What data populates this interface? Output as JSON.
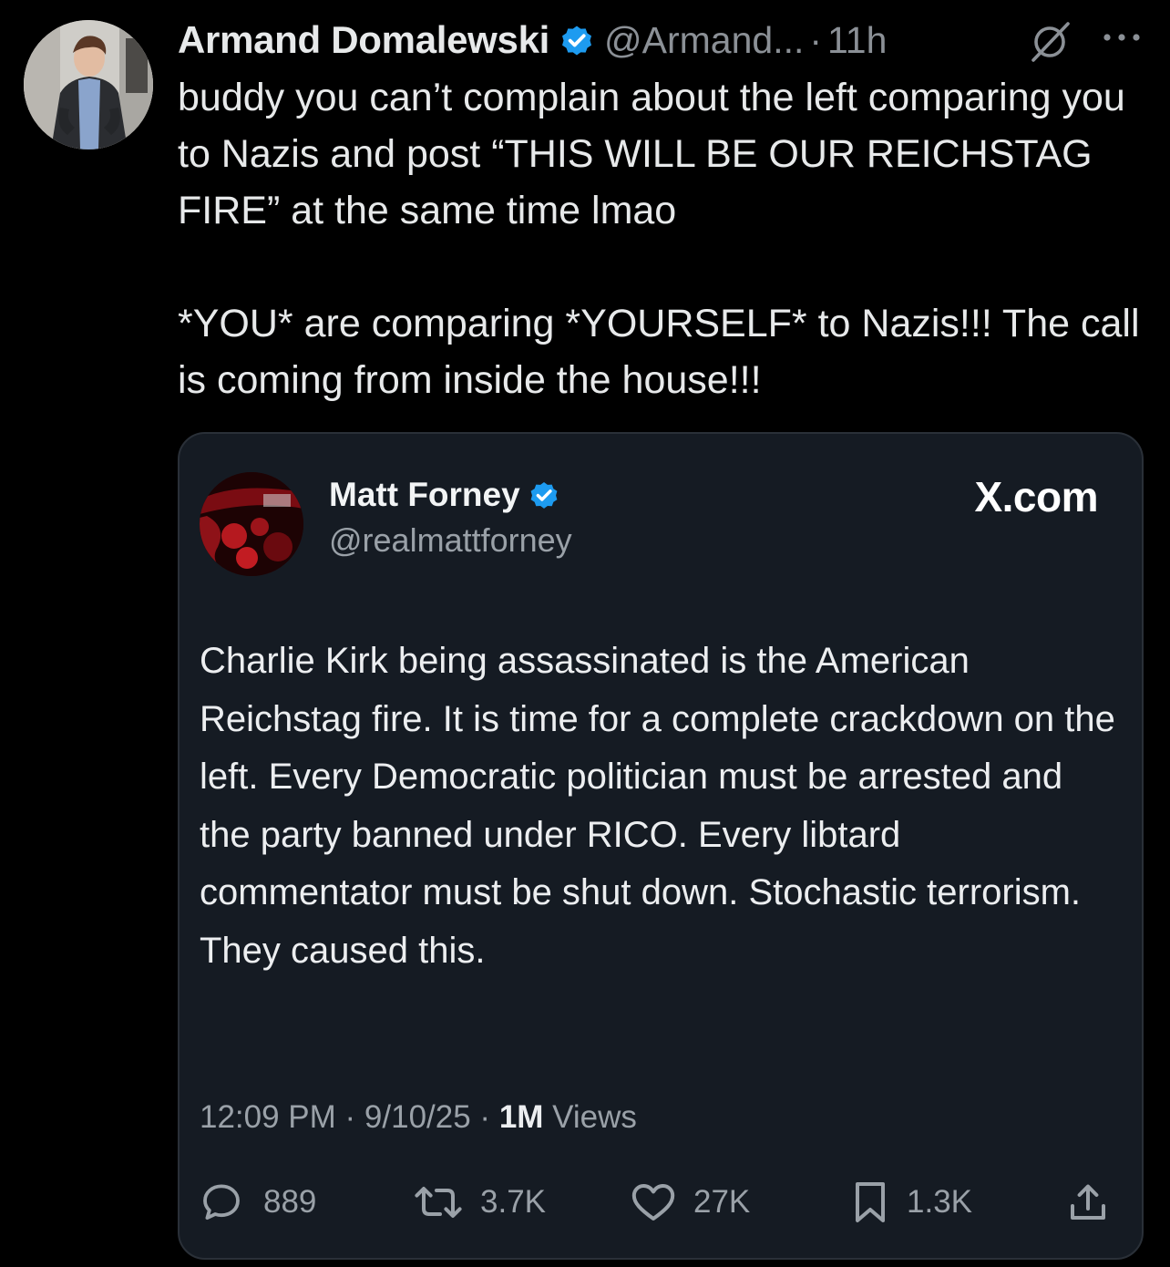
{
  "post": {
    "author": {
      "display_name": "Armand Domalewski",
      "handle": "@Armand...",
      "verified": true,
      "avatar_icon": "user-photo-avatar"
    },
    "separator": "·",
    "time": "11h",
    "icons": {
      "grok": "grok-icon",
      "more": "more-options-icon"
    },
    "text_paragraphs": [
      "buddy you can’t complain about the left comparing you to Nazis and post “THIS WILL BE OUR REICHSTAG FIRE” at the same time lmao",
      "*YOU* are comparing *YOURSELF* to Nazis!!! The call is coming from inside the house!!!"
    ]
  },
  "quoted": {
    "author": {
      "display_name": "Matt Forney",
      "handle": "@realmattforney",
      "verified": true
    },
    "source_label": "X.com",
    "text": "Charlie Kirk being assassinated is the American Reichstag fire. It is time for a complete crackdown on the left. Every Democratic politician must be arrested and the party banned under RICO. Every libtard commentator must be shut down. Stochastic terrorism. They caused this.",
    "meta": {
      "time": "12:09 PM",
      "sep": " · ",
      "date": "9/10/25",
      "views_count": "1M",
      "views_label": "Views"
    },
    "actions": {
      "replies": "889",
      "reposts": "3.7K",
      "likes": "27K",
      "bookmarks": "1.3K"
    }
  },
  "colors": {
    "background": "#000000",
    "text_primary": "#e7e9ea",
    "text_secondary": "#8b9096",
    "verified_badge": "#1d9bf0",
    "card_background": "#151b23"
  }
}
